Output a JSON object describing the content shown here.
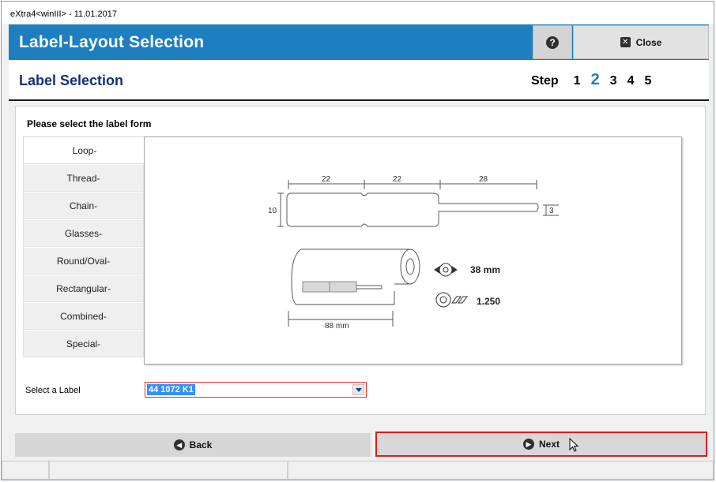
{
  "window": {
    "title": "eXtra4<winIII>  -  11.01.2017"
  },
  "header": {
    "title": "Label-Layout Selection",
    "help_icon": "question-circle-icon",
    "close_label": "Close"
  },
  "subheader": {
    "title": "Label Selection",
    "step_label": "Step",
    "steps": [
      "1",
      "2",
      "3",
      "4",
      "5"
    ],
    "active_step": "2"
  },
  "content": {
    "prompt": "Please select the label form",
    "tabs": [
      {
        "label": "Loop-",
        "active": true
      },
      {
        "label": "Thread-",
        "active": false
      },
      {
        "label": "Chain-",
        "active": false
      },
      {
        "label": "Glasses-",
        "active": false
      },
      {
        "label": "Round/Oval-",
        "active": false
      },
      {
        "label": "Rectangular-",
        "active": false
      },
      {
        "label": "Combined-",
        "active": false
      },
      {
        "label": "Special-",
        "active": false
      }
    ],
    "preview": {
      "dim_top_1": "22",
      "dim_top_2": "22",
      "dim_top_3": "28",
      "dim_height": "10",
      "dim_tail": "3",
      "roll_width": "88 mm",
      "core_diameter": "38 mm",
      "quantity": "1.250"
    },
    "select_label": "Select a Label",
    "select_value": "44 1072 K1"
  },
  "footer": {
    "back_label": "Back",
    "next_label": "Next"
  },
  "colors": {
    "header_blue": "#1d7fbf",
    "title_navy": "#10307a",
    "highlight_red": "#d42020"
  }
}
